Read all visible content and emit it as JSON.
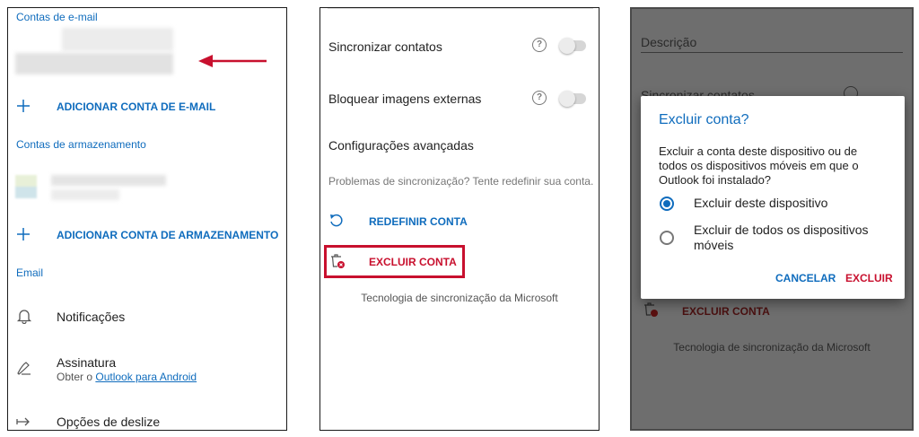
{
  "panel1": {
    "section_email": "Contas de e-mail",
    "add_email": "ADICIONAR CONTA DE E-MAIL",
    "section_storage": "Contas de armazenamento",
    "add_storage": "ADICIONAR CONTA DE ARMAZENAMENTO",
    "section_mail": "Email",
    "notifications": "Notificações",
    "signature": "Assinatura",
    "signature_sub_prefix": "Obter o ",
    "signature_link": "Outlook para Android",
    "swipe": "Opções de deslize",
    "arrow_color": "#c8102e"
  },
  "panel2": {
    "sync_contacts": "Sincronizar contatos",
    "block_images": "Bloquear imagens externas",
    "advanced": "Configurações avançadas",
    "sync_problems": "Problemas de sincronização? Tente redefinir sua conta.",
    "reset": "REDEFINIR CONTA",
    "delete": "EXCLUIR CONTA",
    "powered_by": "Tecnologia de sincronização da Microsoft",
    "highlight_color": "#c8102e"
  },
  "panel3": {
    "background": {
      "description_placeholder": "Descrição",
      "sync_contacts": "Sincronizar contatos",
      "delete": "EXCLUIR CONTA",
      "powered_by": "Tecnologia de sincronização da Microsoft"
    },
    "dialog": {
      "title": "Excluir conta?",
      "message": "Excluir a conta deste dispositivo ou de todos os dispositivos móveis em que o Outlook foi instalado?",
      "option_this_device": "Excluir deste dispositivo",
      "option_all_devices": "Excluir de todos os dispositivos móveis",
      "selected_option": "Excluir deste dispositivo",
      "cancel": "CANCELAR",
      "confirm": "EXCLUIR"
    }
  },
  "colors": {
    "accent": "#0f6cbd",
    "danger": "#c8102e"
  }
}
